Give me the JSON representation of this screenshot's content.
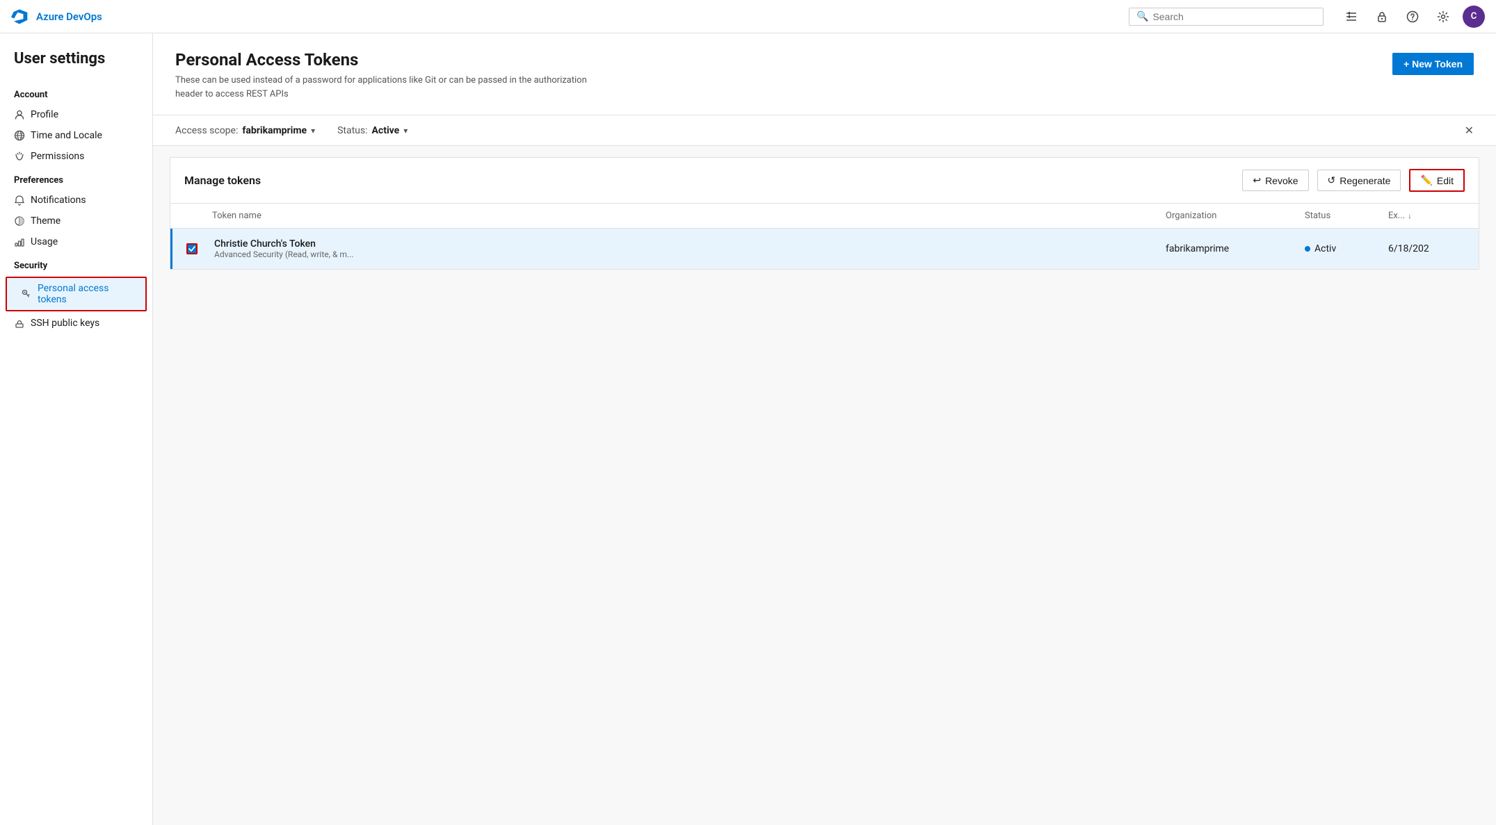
{
  "topnav": {
    "logo_text": "Azure DevOps",
    "search_placeholder": "Search",
    "avatar_initials": "C"
  },
  "sidebar": {
    "title": "User settings",
    "sections": [
      {
        "label": "Account",
        "items": [
          {
            "id": "profile",
            "icon": "👤",
            "label": "Profile",
            "active": false
          },
          {
            "id": "time-locale",
            "icon": "🌐",
            "label": "Time and Locale",
            "active": false
          },
          {
            "id": "permissions",
            "icon": "↻",
            "label": "Permissions",
            "active": false
          }
        ]
      },
      {
        "label": "Preferences",
        "items": [
          {
            "id": "notifications",
            "icon": "🔔",
            "label": "Notifications",
            "active": false
          },
          {
            "id": "theme",
            "icon": "🌙",
            "label": "Theme",
            "active": false
          },
          {
            "id": "usage",
            "icon": "📊",
            "label": "Usage",
            "active": false
          }
        ]
      },
      {
        "label": "Security",
        "items": [
          {
            "id": "pat",
            "icon": "🔑",
            "label": "Personal access tokens",
            "active": true
          },
          {
            "id": "ssh",
            "icon": "🔐",
            "label": "SSH public keys",
            "active": false
          }
        ]
      }
    ]
  },
  "page": {
    "title": "Personal Access Tokens",
    "subtitle": "These can be used instead of a password for applications like Git or can be passed in the authorization header to access REST APIs",
    "new_token_label": "+ New Token"
  },
  "filter": {
    "scope_label": "Access scope:",
    "scope_value": "fabrikamprime",
    "status_label": "Status:",
    "status_value": "Active"
  },
  "manage_tokens": {
    "title": "Manage tokens",
    "revoke_label": "Revoke",
    "regenerate_label": "Regenerate",
    "edit_label": "Edit",
    "table": {
      "headers": [
        "Token name",
        "Organization",
        "Status",
        "Ex..."
      ],
      "rows": [
        {
          "name": "Christie Church's Token",
          "description": "Advanced Security (Read, write, & m...",
          "org": "fabrikamprime",
          "status": "Activ",
          "expiry": "6/18/202"
        }
      ]
    }
  }
}
